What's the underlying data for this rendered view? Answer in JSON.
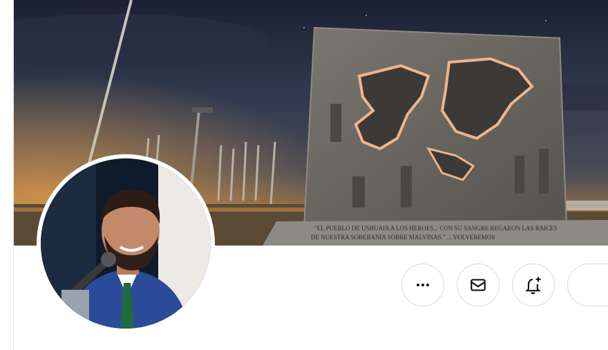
{
  "banner": {
    "monument_inscription_line1": "\"EL PUEBLO DE USHUAIA A LOS HEROES... CON SU SANGRE REGARON LAS RAICES",
    "monument_inscription_line2": "DE NUESTRA SOBERANIA SOBRE MALVINAS.\" ... VOLVEREMOS",
    "colors": {
      "sky_top": "#1c2236",
      "sky_mid": "#3a4256",
      "horizon_glow": "#c9773a",
      "monument": "#6b6862"
    }
  },
  "avatar": {
    "alt_name": "avatar"
  },
  "actions": {
    "more_icon": "ellipsis-icon",
    "message_icon": "envelope-icon",
    "notify_icon": "bell-plus-icon",
    "follow_label": ""
  },
  "colors": {
    "border": "#cfd9de",
    "icon": "#0f1419"
  }
}
